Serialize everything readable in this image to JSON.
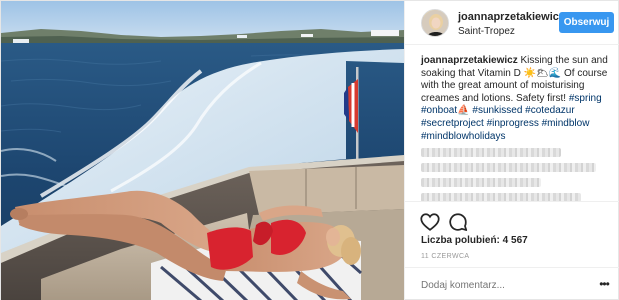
{
  "post": {
    "photo": {
      "alt_icon": "photo"
    },
    "header": {
      "username": "joannaprzetakiewicz",
      "location": "Saint-Tropez",
      "follow_label": "Obserwuj"
    },
    "caption": {
      "username": "joannaprzetakiewicz",
      "text": "Kissing the sun and soaking that Vitamin D ☀️🌥🌊 Of course with the great amount of moisturising creames and lotions. Safety first!",
      "hashtags": "#spring #onboat⛵️ #sunkissed #cotedazur #secretproject #inprogress #mindblow #mindblowholidays"
    },
    "actions": {
      "like_icon": "heart-icon",
      "comment_icon": "comment-icon"
    },
    "likes_text": "Liczba polubień: 4 567",
    "date_text": "11 CZERWCA",
    "comment": {
      "placeholder": "Dodaj komentarz...",
      "more_label": "•••"
    }
  }
}
